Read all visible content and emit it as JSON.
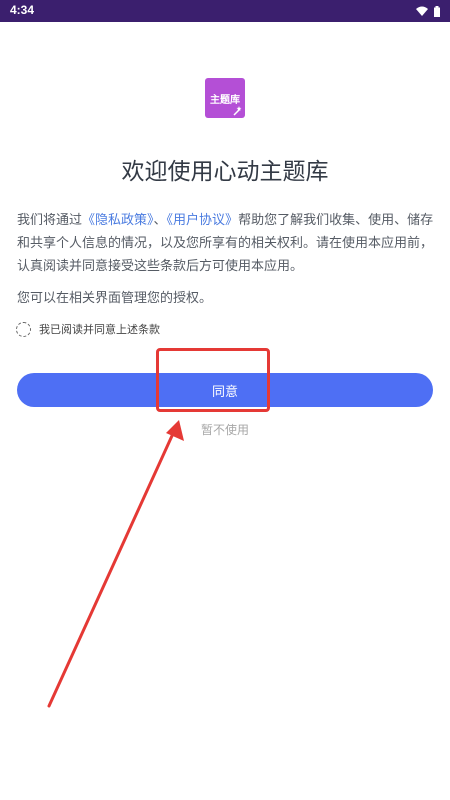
{
  "status_bar": {
    "time": "4:34"
  },
  "app": {
    "logo_text": "主题库"
  },
  "dialog": {
    "title": "欢迎使用心动主题库",
    "intro_part1": "我们将通过",
    "privacy_link": "《隐私政策》",
    "separator": "、",
    "user_agreement_link": "《用户协议》",
    "intro_part2": "帮助您了解我们收集、使用、储存和共享个人信息的情况，以及您所享有的相关权利。请在使用本应用前，认真阅读并同意接受这些条款后方可使用本应用。",
    "manage_text": "您可以在相关界面管理您的授权。",
    "checkbox_label": "我已阅读并同意上述条款",
    "agree_button": "同意",
    "decline_link": "暂不使用"
  },
  "annotation_color": "#e53935"
}
